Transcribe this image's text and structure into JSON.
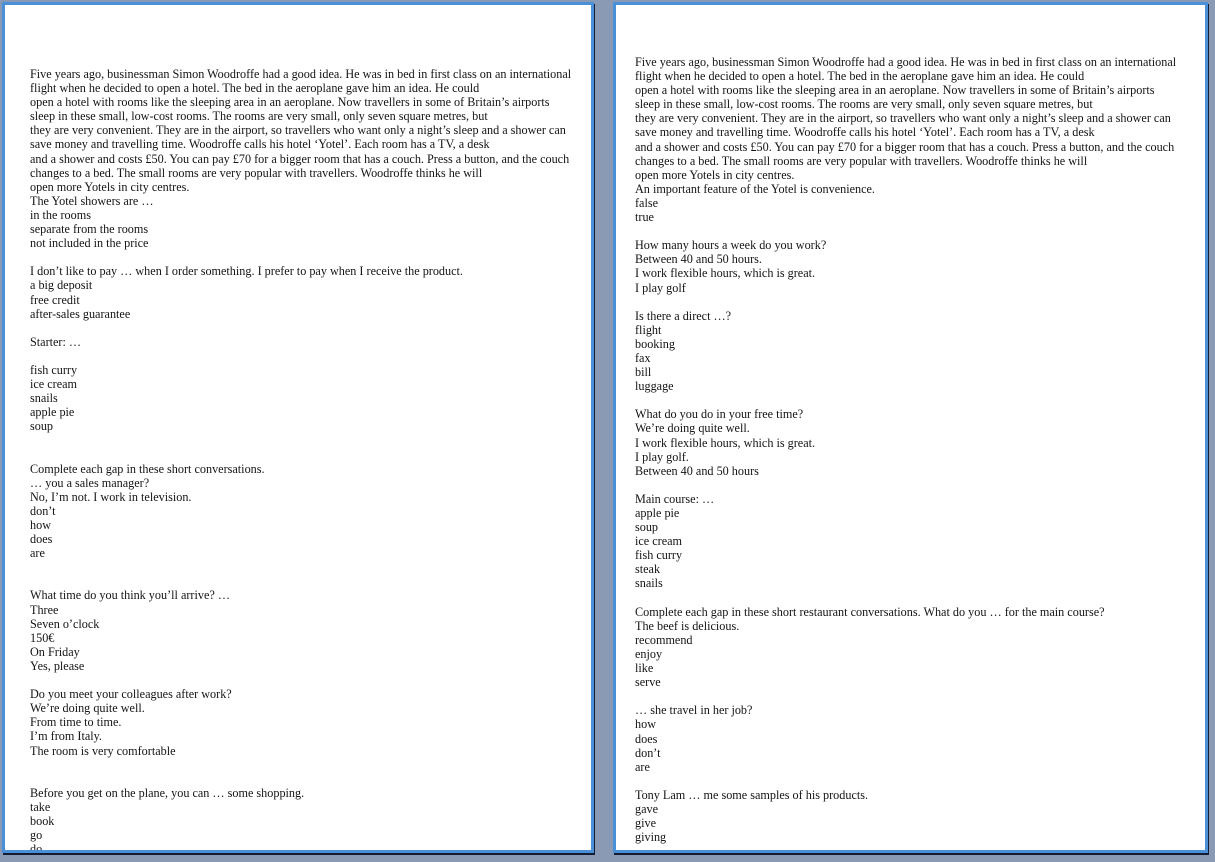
{
  "viewer": {
    "background_color": "#8a9ab5",
    "page_border_color": "#4a90d9",
    "page_background_color": "#ffffff",
    "text_color": "#141414"
  },
  "pages": [
    {
      "name": "left-page",
      "text": "Five years ago, businessman Simon Woodroffe had a good idea. He was in bed in first class on an international\nflight when he decided to open a hotel. The bed in the aeroplane gave him an idea. He could\nopen a hotel with rooms like the sleeping area in an aeroplane. Now travellers in some of Britain’s airports\nsleep in these small, low-cost rooms. The rooms are very small, only seven square metres, but\nthey are very convenient. They are in the airport, so travellers who want only a night’s sleep and a shower can\nsave money and travelling time. Woodroffe calls his hotel ‘Yotel’. Each room has a TV, a desk\nand a shower and costs £50. You can pay £70 for a bigger room that has a couch. Press a button, and the couch\nchanges to a bed. The small rooms are very popular with travellers. Woodroffe thinks he will\nopen more Yotels in city centres.\nThe Yotel showers are …\nin the rooms\nseparate from the rooms\nnot included in the price\n\nI don’t like to pay … when I order something. I prefer to pay when I receive the product.\na big deposit\nfree credit\nafter-sales guarantee\n\nStarter: …\n\nfish curry\nice cream\nsnails\napple pie\nsoup\n\n\nComplete each gap in these short conversations.\n… you a sales manager?\nNo, I’m not. I work in television.\ndon’t\nhow\ndoes\nare\n\n\nWhat time do you think you’ll arrive? …\nThree\nSeven o’clock\n150€\nOn Friday\nYes, please\n\nDo you meet your colleagues after work?\nWe’re doing quite well.\nFrom time to time.\nI’m from Italy.\nThe room is very comfortable\n\n\nBefore you get on the plane, you can … some shopping.\ntake\nbook\ngo\ndo"
    },
    {
      "name": "right-page",
      "text": "Five years ago, businessman Simon Woodroffe had a good idea. He was in bed in first class on an international\nflight when he decided to open a hotel. The bed in the aeroplane gave him an idea. He could\nopen a hotel with rooms like the sleeping area in an aeroplane. Now travellers in some of Britain’s airports\nsleep in these small, low-cost rooms. The rooms are very small, only seven square metres, but\nthey are very convenient. They are in the airport, so travellers who want only a night’s sleep and a shower can\nsave money and travelling time. Woodroffe calls his hotel ‘Yotel’. Each room has a TV, a desk\nand a shower and costs £50. You can pay £70 for a bigger room that has a couch. Press a button, and the couch\nchanges to a bed. The small rooms are very popular with travellers. Woodroffe thinks he will\nopen more Yotels in city centres.\nAn important feature of the Yotel is convenience.\nfalse\ntrue\n\nHow many hours a week do you work?\nBetween 40 and 50 hours.\nI work flexible hours, which is great.\nI play golf\n\nIs there a direct …?\nflight\nbooking\nfax\nbill\nluggage\n\nWhat do you do in your free time?\nWe’re doing quite well.\nI work flexible hours, which is great.\nI play golf.\nBetween 40 and 50 hours\n\nMain course: …\napple pie\nsoup\nice cream\nfish curry\nsteak\nsnails\n\nComplete each gap in these short restaurant conversations. What do you … for the main course?\nThe beef is delicious.\nrecommend\nenjoy\nlike\nserve\n\n… she travel in her job?\nhow\ndoes\ndon’t\nare\n\nTony Lam … me some samples of his products.\ngave\ngive\ngiving"
    }
  ]
}
